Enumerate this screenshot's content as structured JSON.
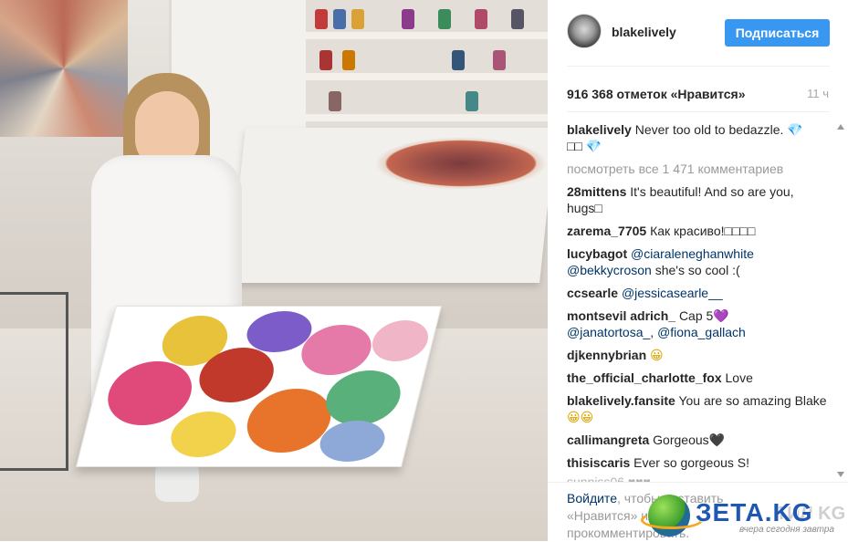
{
  "post": {
    "username": "blakelively",
    "follow_label": "Подписаться",
    "likes": "916 368 отметок «Нравится»",
    "time": "11 ч",
    "caption": {
      "author": "blakelively",
      "text": "Never too old to bedazzle.",
      "emoji_gem": "💎",
      "line2": "□□"
    },
    "view_all": "посмотреть все 1 471 комментариев",
    "comments": [
      {
        "author": "28mittens",
        "text": "It's beautiful! And so are you, hugs□"
      },
      {
        "author": "zarema_7705",
        "text": "Как красиво!□□□□"
      },
      {
        "author": "lucybagot",
        "mention1": "@ciaraleneghanwhite",
        "mention2": "@bekkycroson",
        "text": "she's so cool :("
      },
      {
        "author": "ccsearle",
        "mention1": "@jessicasearle__"
      },
      {
        "author": "montsevil adrich_",
        "text": "Cap 5",
        "heart": "💜",
        "mention1": "@janatortosa_",
        "mention2": "@fiona_gallach"
      },
      {
        "author": "djkennybrian",
        "emoji": "😀"
      },
      {
        "author": "the_official_charlotte_fox",
        "text": "Love"
      },
      {
        "author": "blakelively.fansite",
        "text": "You are so amazing Blake",
        "emoji": "😀😀"
      },
      {
        "author": "callimangreta",
        "text": "Gorgeous",
        "heart": "🖤"
      },
      {
        "author": "thisiscaris",
        "text": "Ever so gorgeous S!"
      }
    ],
    "cutoff_text": "sunniss06 ♥♥♥"
  },
  "footer": {
    "login_link": "Войдите",
    "login_rest": ", чтобы поставить «Нравится» или прокомментировать."
  },
  "watermark": {
    "brand": "ЗЕТА.KG",
    "ghost": "ТИЛ KG",
    "tagline": "вчера сегодня завтра"
  }
}
